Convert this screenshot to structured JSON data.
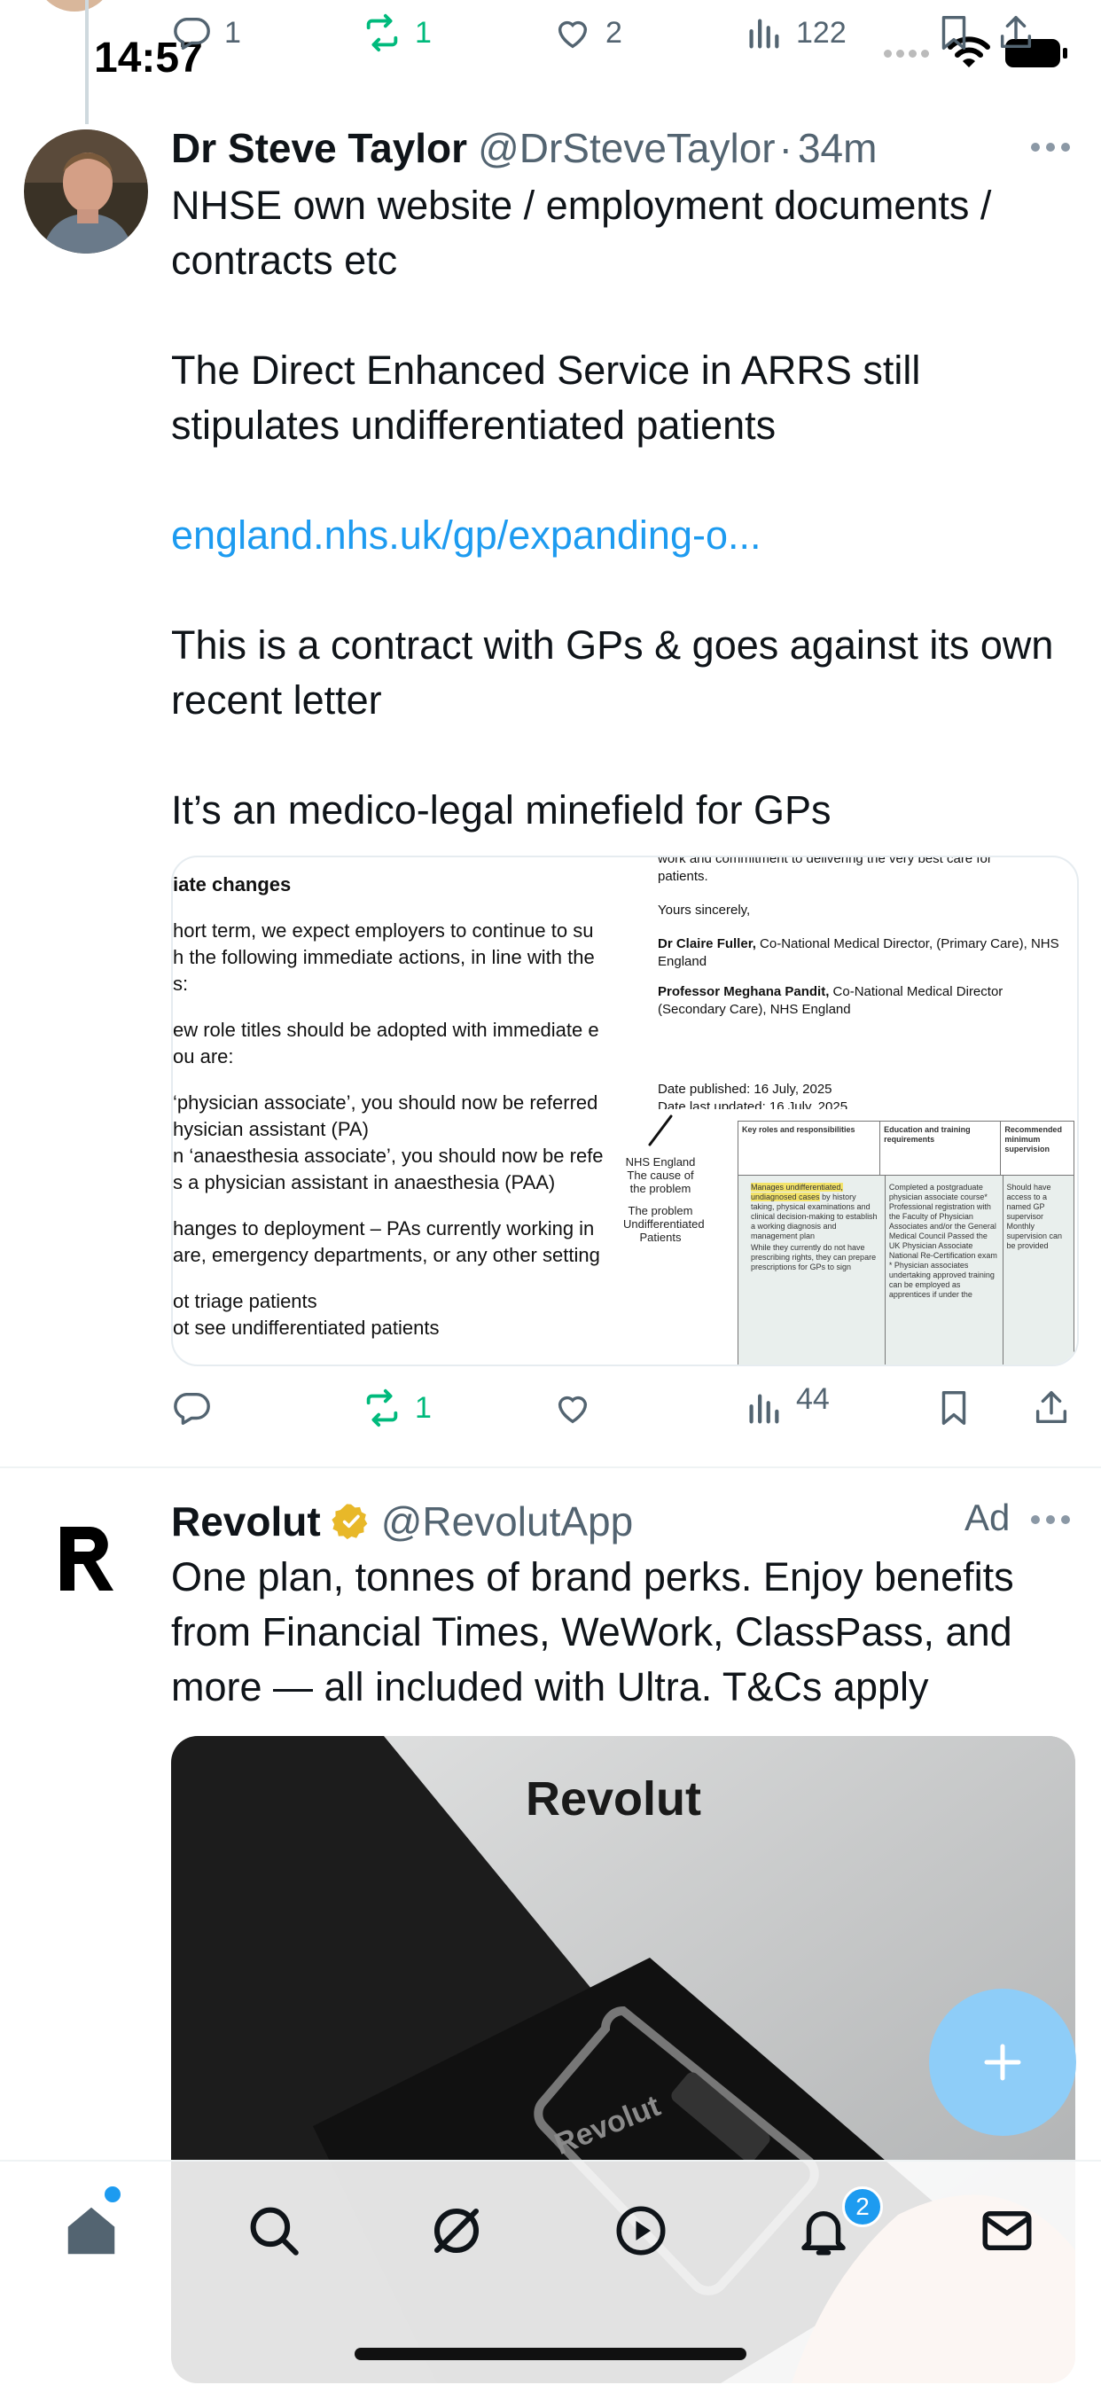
{
  "status_bar": {
    "time": "14:57"
  },
  "previous_tweet": {
    "actions": {
      "replies": "1",
      "reposts": "1",
      "likes": "2",
      "views": "122"
    }
  },
  "tweet": {
    "display_name": "Dr Steve Taylor",
    "handle": "@DrSteveTaylor",
    "separator": "·",
    "time_ago": "34m",
    "paragraphs": [
      "NHSE own website / employment documents / contracts etc",
      "The Direct Enhanced Service in ARRS still stipulates undifferentiated patients"
    ],
    "link_text": "england.nhs.uk/gp/expanding-o...",
    "paragraphs_after": [
      "This is a contract with GPs & goes against its own recent letter",
      "It’s an medico-legal minefield for GPs"
    ],
    "image": {
      "left_heading": "iate changes",
      "left_lines": [
        "hort term, we expect employers to continue to su",
        "h the following immediate actions, in line with the",
        "s:",
        "",
        "ew role titles should be adopted with immediate e",
        "ou are:",
        "",
        "‘physician associate’, you should now be referred",
        "hysician assistant (PA)",
        "n ‘anaesthesia associate’, you should now be refe",
        "s a physician assistant in anaesthesia (PAA)",
        "",
        "hanges to deployment – PAs currently working in",
        "are, emergency departments, or any other setting",
        "",
        "ot triage patients",
        "ot see undifferentiated patients"
      ],
      "right_top_lines": [
        "work and commitment to delivering the very best care for",
        "patients.",
        "",
        "Yours sincerely,"
      ],
      "signatory1_name": "Dr Claire Fuller,",
      "signatory1_role": "Co-National Medical Director, (Primary Care), NHS England",
      "signatory2_name": "Professor Meghana Pandit,",
      "signatory2_role": "Co-National Medical Director (Secondary Care), NHS England",
      "date_published": "Date published: 16 July, 2025",
      "date_updated": "Date last updated: 16 July, 2025",
      "annotation_lines": [
        "NHS England",
        "The cause of",
        "the problem",
        "",
        "The problem",
        "Undifferentiated",
        "Patients"
      ],
      "table_headers": [
        "Key roles and responsibilities",
        "Education and training requirements",
        "Recommended minimum supervision"
      ],
      "table_col1_highlight": "Manages undifferentiated, undiagnosed cases",
      "table_col1_rest": "by history taking, physical examinations and clinical decision-making to establish a working diagnosis and management plan",
      "table_col1_bullet2": "While they currently do not have prescribing rights, they can prepare prescriptions for GPs to sign",
      "table_col2": "Completed a postgraduate physician associate course* Professional registration with the Faculty of Physician Associates and/or the General Medical Council Passed the UK Physician Associate National Re-Certification exam * Physician associates undertaking approved training can be employed as apprentices if under the",
      "table_col3": "Should have access to a named GP supervisor Monthly supervision can be provided"
    },
    "actions": {
      "replies": "",
      "reposts": "1",
      "likes": "",
      "views": "44"
    }
  },
  "ad": {
    "display_name": "Revolut",
    "handle": "@RevolutApp",
    "ad_label": "Ad",
    "text": "One plan, tonnes of brand perks. Enjoy benefits from Financial Times, WeWork, ClassPass, and more — all included with Ultra. T&Cs apply",
    "image_brand": "Revolut",
    "image_card_text": "Revolut"
  },
  "bottom_nav": {
    "notifications_badge": "2"
  },
  "colors": {
    "accent": "#1d9bf0",
    "repost_green": "#00ba7c",
    "muted": "#536471",
    "verified_gold": "#e8b829"
  },
  "icons": [
    "reply-icon",
    "repost-icon",
    "like-icon",
    "views-icon",
    "bookmark-icon",
    "share-icon",
    "more-icon",
    "verified-icon",
    "home-icon",
    "search-icon",
    "grok-icon",
    "video-icon",
    "notifications-icon",
    "messages-icon",
    "compose-icon"
  ]
}
